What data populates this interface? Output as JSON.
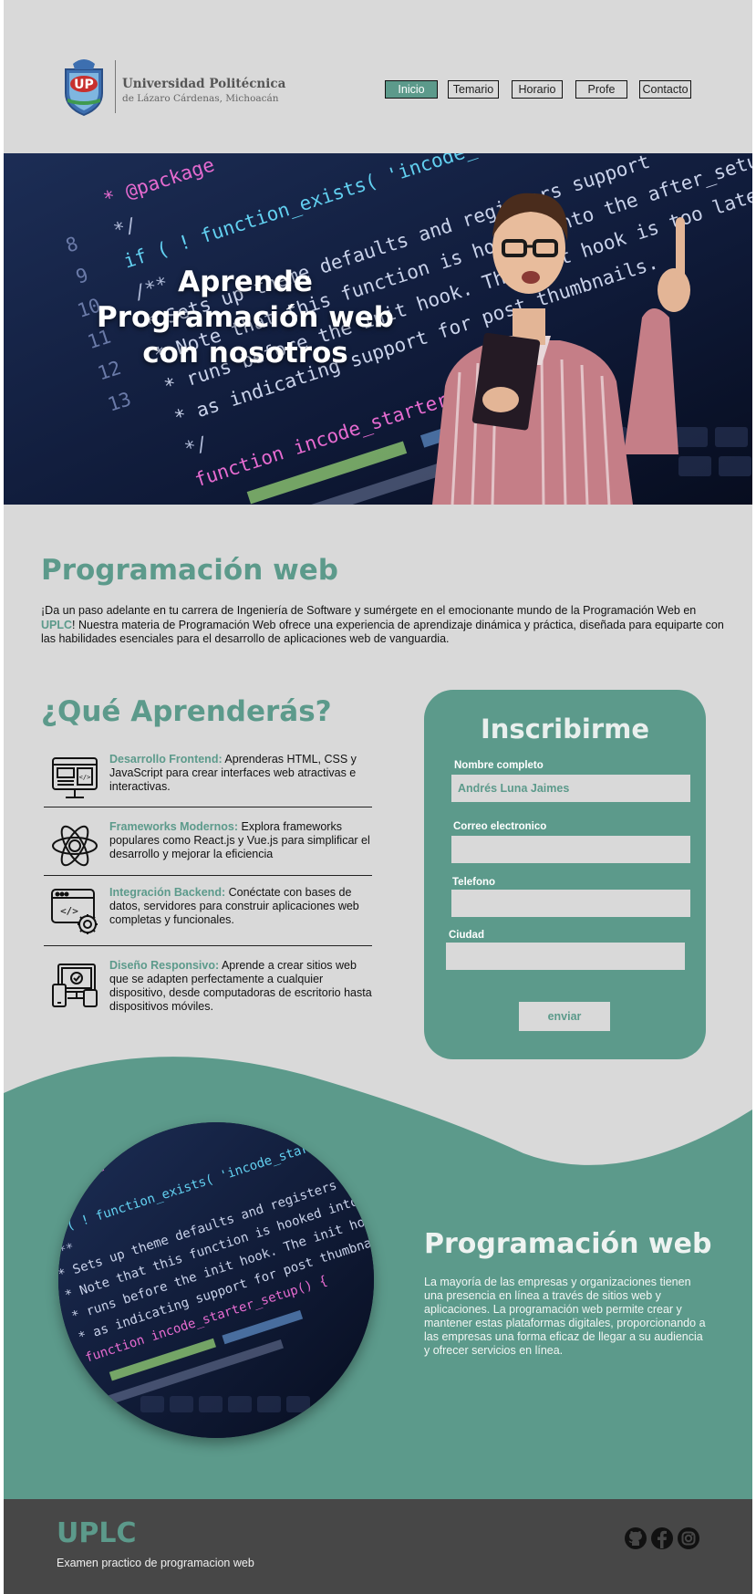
{
  "header": {
    "logo_name": "Universidad Politécnica",
    "logo_sub": "de Lázaro Cárdenas, Michoacán",
    "logo_text": "UP",
    "nav": [
      "Inicio",
      "Temario",
      "Horario",
      "Profe",
      "Contacto"
    ],
    "active_nav": "Inicio"
  },
  "hero": {
    "title": "Aprende Programación web con nosotros",
    "code_lines": [
      "* @package",
      "*/",
      "if ( ! function_exists( 'incode_starter_setup' ) ) :",
      "/**",
      " * Sets up theme defaults and registers support",
      " * Note that this function is hooked into the after_setup",
      " * runs before the init hook. The init hook is too late",
      " * as indicating support for post thumbnails.",
      " */",
      "function incode_starter_setup() {"
    ],
    "line_numbers": [
      "8",
      "9",
      "10",
      "11",
      "12",
      "13"
    ]
  },
  "about": {
    "title": "Programación web",
    "text_1": "¡Da un paso adelante en tu carrera de Ingeniería de Software y sumérgete en el emocionante mundo de la Programación Web en ",
    "highlight": "UPLC",
    "text_2": "! Nuestra materia de Programación Web ofrece una experiencia de aprendizaje dinámica y práctica, diseñada para equiparte con las habilidades esenciales para el desarrollo de aplicaciones web de vanguardia."
  },
  "learn": {
    "title": "¿Qué Aprenderás?",
    "items": [
      {
        "title": "Desarrollo Frontend:",
        "text": " Aprenderas  HTML, CSS y JavaScript para crear interfaces web atractivas e interactivas.",
        "icon": "web-layout-icon"
      },
      {
        "title": "Frameworks Modernos:",
        "text": " Explora frameworks populares como React.js y Vue.js para simplificar el desarrollo y mejorar la eficiencia",
        "icon": "atom-icon"
      },
      {
        "title": "Integración Backend:",
        "text": " Conéctate con bases de datos, servidores para construir aplicaciones web completas y funcionales.",
        "icon": "code-gear-icon"
      },
      {
        "title": "Diseño Responsivo:",
        "text": " Aprende a crear sitios web que se adapten perfectamente a cualquier dispositivo, desde computadoras de escritorio hasta dispositivos móviles.",
        "icon": "responsive-devices-icon"
      }
    ]
  },
  "form": {
    "title": "Inscribirme",
    "name_label": "Nombre completo",
    "name_value": "Andrés Luna Jaimes",
    "email_label": "Correo electronico",
    "email_value": "",
    "phone_label": "Telefono",
    "phone_value": "",
    "city_label": "Ciudad",
    "city_value": "",
    "submit": "enviar"
  },
  "feature": {
    "title": "Programación web",
    "text": "La mayoría de las empresas y organizaciones tienen una presencia en línea a través de sitios web y aplicaciones. La programación web permite crear y mantener estas plataformas digitales, proporcionando a las empresas una forma eficaz de llegar a su audiencia y ofrecer servicios en línea."
  },
  "footer": {
    "brand": "UPLC",
    "subtitle": "Examen practico de programacion web",
    "social": [
      "github-icon",
      "facebook-icon",
      "instagram-icon"
    ]
  },
  "colors": {
    "accent": "#5c9a8b",
    "background": "#d9d9d9",
    "footer": "#474747",
    "hero_dark": "#0c1630"
  }
}
